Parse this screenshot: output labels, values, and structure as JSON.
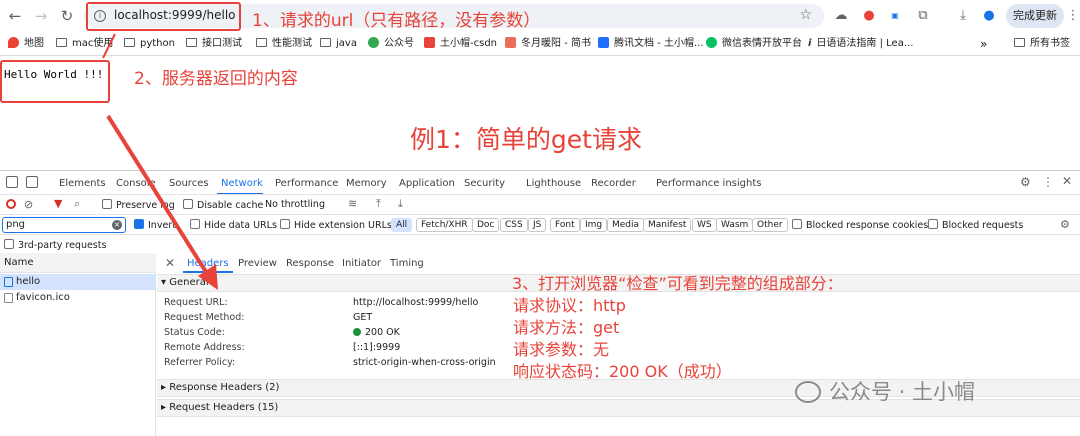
{
  "browser": {
    "url": "localhost:9999/hello",
    "update_label": "完成更新",
    "bookmarks": [
      "地图",
      "mac使用",
      "python",
      "接口测试",
      "性能测试",
      "java",
      "公众号",
      "土小帽-csdn",
      "冬月暖阳 - 简书",
      "腾讯文档 - 土小帽...",
      "微信表情开放平台",
      "日语语法指南 | Lea..."
    ],
    "bookmarks_more": "»",
    "all_bookmarks": "所有书签"
  },
  "page": {
    "body_text": "Hello  World !!!"
  },
  "annotations": {
    "a1": "1、请求的url（只有路径，没有参数）",
    "a2": "2、服务器返回的内容",
    "example_title": "例1：简单的get请求",
    "a3_title": "3、打开浏览器“检查”可看到完整的组成部分：",
    "a3_lines": [
      "请求协议：http",
      "请求方法：get",
      "请求参数：无",
      "响应状态码：200 OK（成功）"
    ],
    "watermark": "公众号 · 土小帽"
  },
  "devtools": {
    "tabs": [
      "Elements",
      "Console",
      "Sources",
      "Network",
      "Performance",
      "Memory",
      "Application",
      "Security",
      "Lighthouse",
      "Recorder",
      "Performance insights"
    ],
    "active_tab": "Network",
    "toolbar": {
      "preserve_log": "Preserve log",
      "disable_cache": "Disable cache",
      "throttling": "No throttling"
    },
    "filter": {
      "value": "png",
      "invert": "Invert",
      "hide_data_urls": "Hide data URLs",
      "hide_extension_urls": "Hide extension URLs",
      "types": [
        "All",
        "Fetch/XHR",
        "Doc",
        "CSS",
        "JS",
        "Font",
        "Img",
        "Media",
        "Manifest",
        "WS",
        "Wasm",
        "Other"
      ],
      "blocked_cookies": "Blocked response cookies",
      "blocked_requests": "Blocked requests",
      "third_party": "3rd-party requests"
    },
    "requests_header": "Name",
    "requests": [
      "hello",
      "favicon.ico"
    ],
    "subtabs": [
      "Headers",
      "Preview",
      "Response",
      "Initiator",
      "Timing"
    ],
    "active_subtab": "Headers",
    "general_label": "General",
    "general": [
      {
        "k": "Request URL:",
        "v": "http://localhost:9999/hello"
      },
      {
        "k": "Request Method:",
        "v": "GET"
      },
      {
        "k": "Status Code:",
        "v": "200 OK"
      },
      {
        "k": "Remote Address:",
        "v": "[::1]:9999"
      },
      {
        "k": "Referrer Policy:",
        "v": "strict-origin-when-cross-origin"
      }
    ],
    "response_headers": "Response Headers (2)",
    "request_headers": "Request Headers (15)"
  }
}
